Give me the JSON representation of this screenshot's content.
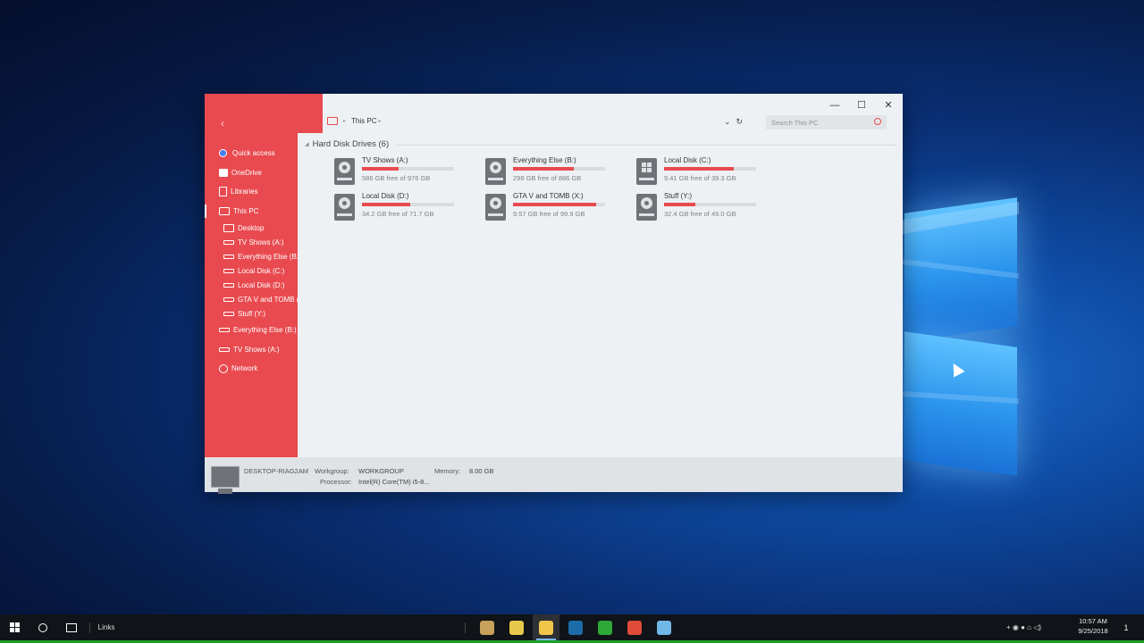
{
  "window": {
    "address": "This PC",
    "search_placeholder": "Search This PC",
    "controls": {
      "minimize": "—",
      "maximize": "☐",
      "close": "✕"
    },
    "back_glyph": "‹",
    "refresh_glyph": "↻",
    "dropdown_glyph": "⌄"
  },
  "sidebar": {
    "items": [
      {
        "label": "Quick access",
        "icon": "star-icon",
        "level": 1
      },
      {
        "label": "OneDrive",
        "icon": "folder-icon",
        "level": 1
      },
      {
        "label": "Libraries",
        "icon": "library-icon",
        "level": 1
      },
      {
        "label": "This PC",
        "icon": "pc-icon",
        "level": 1,
        "selected": true
      },
      {
        "label": "Desktop",
        "icon": "desktop-icon",
        "level": 2
      },
      {
        "label": "TV Shows (A:)",
        "icon": "drive-icon",
        "level": 2
      },
      {
        "label": "Everything Else (B:)",
        "icon": "drive-icon",
        "level": 2
      },
      {
        "label": "Local Disk (C:)",
        "icon": "drive-icon",
        "level": 2
      },
      {
        "label": "Local Disk (D:)",
        "icon": "drive-icon",
        "level": 2
      },
      {
        "label": "GTA V and TOMB (X:)",
        "icon": "drive-icon",
        "level": 2
      },
      {
        "label": "Stuff (Y:)",
        "icon": "drive-icon",
        "level": 2
      },
      {
        "label": "Everything Else (B:)",
        "icon": "drive-icon",
        "level": 1
      },
      {
        "label": "TV Shows (A:)",
        "icon": "drive-icon",
        "level": 1
      },
      {
        "label": "Network",
        "icon": "network-icon",
        "level": 1
      }
    ]
  },
  "section": {
    "title": "Hard Disk Drives (6)"
  },
  "drives": [
    {
      "name": "TV Shows (A:)",
      "free": "586 GB free of 976 GB",
      "used_fraction": 0.4,
      "icon": "hdd"
    },
    {
      "name": "Everything Else (B:)",
      "free": "298 GB free of 886 GB",
      "used_fraction": 0.66,
      "icon": "hdd"
    },
    {
      "name": "Local Disk (C:)",
      "free": "9.41 GB free of 39.3 GB",
      "used_fraction": 0.76,
      "icon": "windows"
    },
    {
      "name": "Local Disk (D:)",
      "free": "34.2 GB free of 71.7 GB",
      "used_fraction": 0.52,
      "icon": "hdd"
    },
    {
      "name": "GTA V and TOMB (X:)",
      "free": "9.57 GB free of 99.9 GB",
      "used_fraction": 0.9,
      "icon": "hdd"
    },
    {
      "name": "Stuff (Y:)",
      "free": "32.4 GB free of 49.0 GB",
      "used_fraction": 0.34,
      "icon": "hdd"
    }
  ],
  "details": {
    "computer_name": "DESKTOP-RIAG2AM",
    "workgroup_label": "Workgroup:",
    "workgroup_value": "WORKGROUP",
    "memory_label": "Memory:",
    "memory_value": "8.00 GB",
    "processor_label": "Processor:",
    "processor_value": "Intel(R) Core(TM) i5-8..."
  },
  "taskbar": {
    "links_label": "Links",
    "apps": [
      {
        "name": "paint-app",
        "color": "#c8a15a"
      },
      {
        "name": "tools-app",
        "color": "#e8c84a"
      },
      {
        "name": "file-explorer",
        "color": "#f2c54b",
        "active": true
      },
      {
        "name": "steam",
        "color": "#1b6ca8"
      },
      {
        "name": "camtasia",
        "color": "#2fa83a"
      },
      {
        "name": "chrome",
        "color": "#e04b3a"
      },
      {
        "name": "notepad",
        "color": "#6fb8e8"
      }
    ],
    "tray_glyphs": "+  ◉  ●  ⌂  ◁)",
    "time": "10:57 AM",
    "date": "9/25/2018",
    "notification_count": "1"
  },
  "colors": {
    "accent": "#e84a4f",
    "bar_track": "#d9dcdf",
    "window_bg": "#eef1f4"
  }
}
